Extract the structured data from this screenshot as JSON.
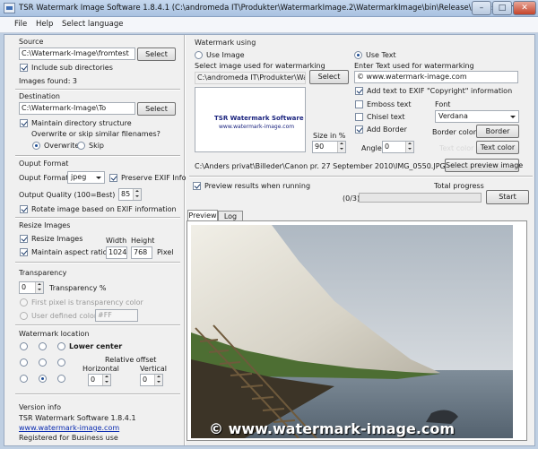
{
  "window": {
    "title": "TSR Watermark Image Software 1.8.4.1 (C:\\andromeda IT\\Produkter\\WatermarkImage.2\\WatermarkImage\\bin\\Release\\bartest.wmi)",
    "minimize_icon": "minimize-icon",
    "maximize_icon": "maximize-icon",
    "close_icon": "close-icon"
  },
  "menu": {
    "file": "File",
    "help": "Help",
    "language": "Select language"
  },
  "source": {
    "header": "Source",
    "path": "C:\\Watermark-Image\\fromtest",
    "select_label": "Select",
    "include_sub": "Include sub directories",
    "include_sub_checked": true,
    "images_found": "Images found: 3"
  },
  "destination": {
    "header": "Destination",
    "path": "C:\\Watermark-Image\\To",
    "select_label": "Select",
    "maintain_structure": "Maintain directory structure",
    "maintain_structure_checked": true,
    "overwrite_question": "Overwrite or skip similar filenames?",
    "overwrite": "Overwrite",
    "skip": "Skip",
    "overwrite_selected": true
  },
  "output_format": {
    "header": "Ouput Format",
    "format_label": "Ouput Format",
    "format_value": "jpeg",
    "preserve_exif": "Preserve EXIF Info",
    "preserve_exif_checked": true,
    "quality_label": "Output Quality (100=Best)",
    "quality_value": "85",
    "rotate_exif": "Rotate image based on EXIF information",
    "rotate_exif_checked": true
  },
  "resize": {
    "header": "Resize Images",
    "resize_label": "Resize Images",
    "resize_checked": true,
    "aspect_label": "Maintain aspect ratio",
    "aspect_checked": true,
    "width_label": "Width",
    "height_label": "Height",
    "width": "1024",
    "height": "768",
    "unit": "Pixel"
  },
  "transparency": {
    "header": "Transparency",
    "value": "0",
    "label": "Transparency %",
    "first_pixel": "First pixel is transparency color",
    "user_defined": "User defined color",
    "color_value": "#FF"
  },
  "location": {
    "header": "Watermark location",
    "selected_label": "Lower center",
    "relative_offset": "Relative offset",
    "horizontal_label": "Horizontal",
    "vertical_label": "Vertical",
    "horizontal": "0",
    "vertical": "0"
  },
  "version": {
    "header": "Version info",
    "name": "TSR Watermark Software 1.8.4.1",
    "website": "www.watermark-image.com",
    "registered": "Registered for Business use"
  },
  "watermark": {
    "header": "Watermark using",
    "use_image": "Use Image",
    "use_text": "Use Text",
    "use_text_selected": true,
    "image_label": "Select image used for watermarking",
    "image_path": "C:\\andromeda IT\\Produkter\\Watermark",
    "image_select": "Select",
    "thumb_title": "TSR Watermark Software",
    "thumb_url": "www.watermark-image.com",
    "size_label": "Size in %",
    "size_value": "90",
    "text_label": "Enter Text used for watermarking",
    "text_value": "© www.watermark-image.com",
    "exif_copyright": "Add text to EXIF \"Copyright\" information",
    "exif_copyright_checked": true,
    "emboss": "Emboss text",
    "chisel": "Chisel text",
    "add_border": "Add Border",
    "add_border_checked": true,
    "font_label": "Font",
    "font_value": "Verdana",
    "border_color_label": "Border color",
    "border_button": "Border",
    "text_color_label": "Text color",
    "text_color_button": "Text color",
    "angle_label": "Angle",
    "angle_value": "0",
    "preview_file": "C:\\Anders privat\\Billeder\\Canon pr. 27 September 2010\\IMG_0550.JPG",
    "select_preview": "Select preview image"
  },
  "run": {
    "preview_running": "Preview results when running",
    "preview_running_checked": true,
    "total_progress": "Total progress",
    "count": "(0/3)",
    "progress_fraction": 0,
    "start": "Start"
  },
  "tabs": {
    "preview": "Preview",
    "log": "Log"
  },
  "preview": {
    "watermark_text": "© www.watermark-image.com"
  },
  "colors": {
    "accent": "#1f4f95",
    "link": "#0a2bb0"
  }
}
